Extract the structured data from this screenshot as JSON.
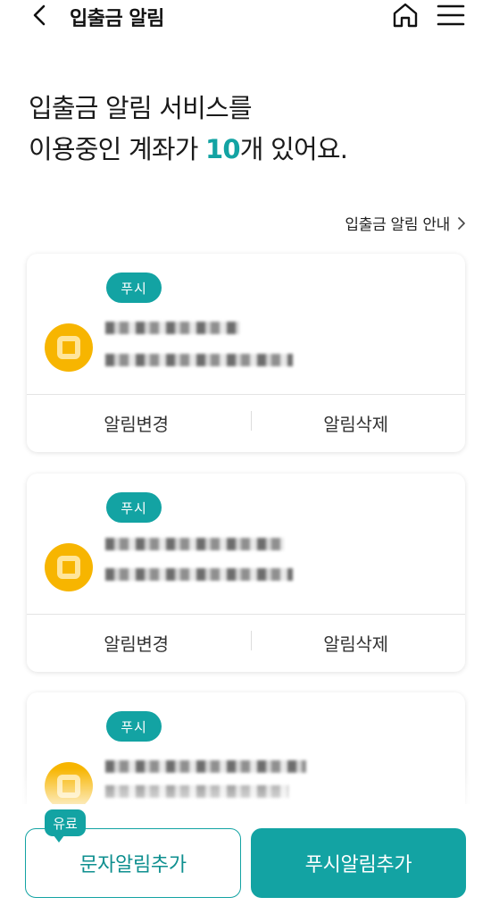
{
  "header": {
    "title": "입출금 알림"
  },
  "headline": {
    "line1": "입출금 알림 서비스를",
    "line2_prefix": "이용중인 계좌가 ",
    "count": "10",
    "line2_suffix": "개 있어요."
  },
  "guide_link": {
    "label": "입출금 알림 안내"
  },
  "accounts": [
    {
      "badge": "푸시",
      "change_label": "알림변경",
      "delete_label": "알림삭제"
    },
    {
      "badge": "푸시",
      "change_label": "알림변경",
      "delete_label": "알림삭제"
    },
    {
      "badge": "푸시"
    }
  ],
  "bottom": {
    "paid_tag": "유료",
    "sms_button": "문자알림추가",
    "push_button": "푸시알림추가"
  },
  "colors": {
    "accent": "#13a3a3",
    "bank_logo": "#f7b500"
  }
}
